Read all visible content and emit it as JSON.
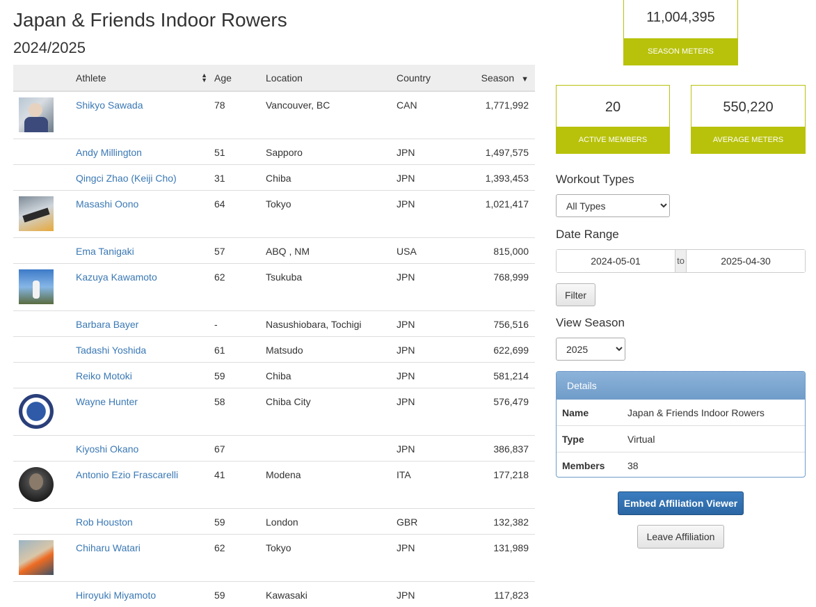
{
  "header": {
    "title": "Japan & Friends Indoor Rowers",
    "subtitle": "2024/2025"
  },
  "table": {
    "columns": {
      "athlete": "Athlete",
      "age": "Age",
      "location": "Location",
      "country": "Country",
      "season": "Season"
    },
    "rows": [
      {
        "name": "Shikyo Sawada",
        "age": "78",
        "location": "Vancouver, BC",
        "country": "CAN",
        "meters": "1,771,992"
      },
      {
        "name": "Andy Millington",
        "age": "51",
        "location": "Sapporo",
        "country": "JPN",
        "meters": "1,497,575"
      },
      {
        "name": "Qingci Zhao (Keiji Cho)",
        "age": "31",
        "location": "Chiba",
        "country": "JPN",
        "meters": "1,393,453"
      },
      {
        "name": "Masashi Oono",
        "age": "64",
        "location": "Tokyo",
        "country": "JPN",
        "meters": "1,021,417"
      },
      {
        "name": "Ema Tanigaki",
        "age": "57",
        "location": "ABQ , NM",
        "country": "USA",
        "meters": "815,000"
      },
      {
        "name": "Kazuya Kawamoto",
        "age": "62",
        "location": "Tsukuba",
        "country": "JPN",
        "meters": "768,999"
      },
      {
        "name": "Barbara Bayer",
        "age": "-",
        "location": "Nasushiobara, Tochigi",
        "country": "JPN",
        "meters": "756,516"
      },
      {
        "name": "Tadashi Yoshida",
        "age": "61",
        "location": "Matsudo",
        "country": "JPN",
        "meters": "622,699"
      },
      {
        "name": "Reiko Motoki",
        "age": "59",
        "location": "Chiba",
        "country": "JPN",
        "meters": "581,214"
      },
      {
        "name": "Wayne Hunter",
        "age": "58",
        "location": "Chiba City",
        "country": "JPN",
        "meters": "576,479"
      },
      {
        "name": "Kiyoshi Okano",
        "age": "67",
        "location": "",
        "country": "JPN",
        "meters": "386,837"
      },
      {
        "name": "Antonio Ezio Frascarelli",
        "age": "41",
        "location": "Modena",
        "country": "ITA",
        "meters": "177,218"
      },
      {
        "name": "Rob Houston",
        "age": "59",
        "location": "London",
        "country": "GBR",
        "meters": "132,382"
      },
      {
        "name": "Chiharu Watari",
        "age": "62",
        "location": "Tokyo",
        "country": "JPN",
        "meters": "131,989"
      },
      {
        "name": "Hiroyuki Miyamoto",
        "age": "59",
        "location": "Kawasaki",
        "country": "JPN",
        "meters": "117,823"
      }
    ]
  },
  "stats": {
    "season_meters": {
      "value": "11,004,395",
      "label": "SEASON METERS"
    },
    "active_members": {
      "value": "20",
      "label": "ACTIVE MEMBERS"
    },
    "average_meters": {
      "value": "550,220",
      "label": "AVERAGE METERS"
    }
  },
  "filters": {
    "workout_types_label": "Workout Types",
    "workout_type_selected": "All Types",
    "date_range_label": "Date Range",
    "date_start": "2024-05-01",
    "date_to": "to",
    "date_end": "2025-04-30",
    "filter_button": "Filter",
    "view_season_label": "View Season",
    "season_selected": "2025"
  },
  "details": {
    "header": "Details",
    "name_label": "Name",
    "name_value": "Japan & Friends Indoor Rowers",
    "type_label": "Type",
    "type_value": "Virtual",
    "members_label": "Members",
    "members_value": "38"
  },
  "actions": {
    "embed_button": "Embed Affiliation Viewer",
    "leave_button": "Leave Affiliation"
  },
  "colors": {
    "accent": "#b8c20b",
    "link": "#3a78b4",
    "panel_header": "#6f9cc9",
    "embed_button": "#2b66a3"
  }
}
